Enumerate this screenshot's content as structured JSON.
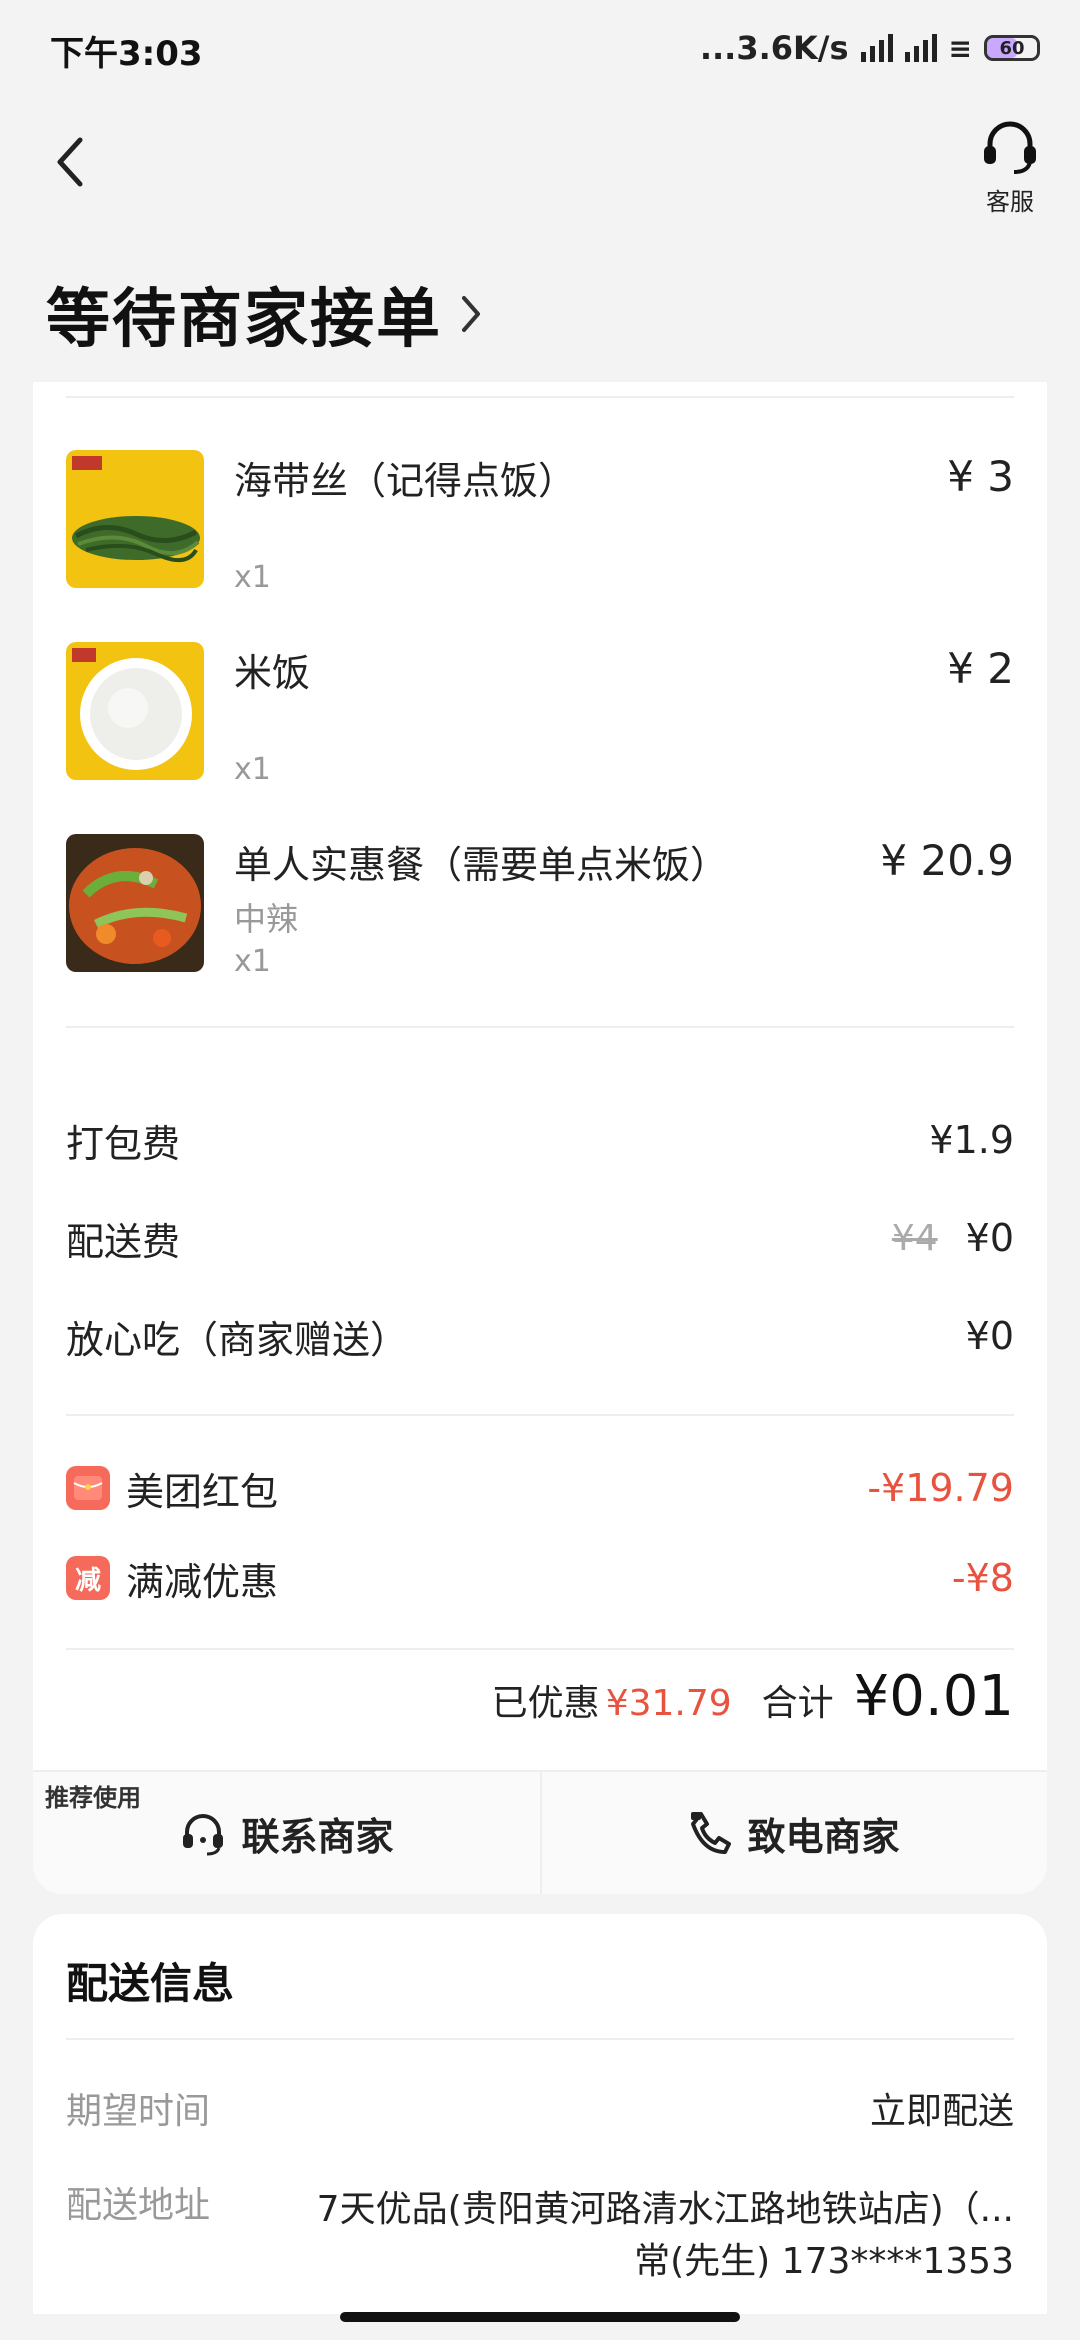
{
  "status_bar": {
    "time": "下午3:03",
    "net_speed": "...3.6K/s",
    "battery": "60"
  },
  "header": {
    "service_label": "客服",
    "title": "等待商家接单"
  },
  "items": [
    {
      "name": "海带丝（记得点饭）",
      "spec": "",
      "qty": "x1",
      "price": "¥ 3"
    },
    {
      "name": "米饭",
      "spec": "",
      "qty": "x1",
      "price": "¥ 2"
    },
    {
      "name": "单人实惠餐（需要单点米饭）",
      "spec": "中辣",
      "qty": "x1",
      "price": "¥ 20.9"
    }
  ],
  "fees": {
    "packing_label": "打包费",
    "packing_value": "¥1.9",
    "delivery_label": "配送费",
    "delivery_original": "¥4",
    "delivery_value": "¥0",
    "assurance_label": "放心吃（商家赠送）",
    "assurance_value": "¥0"
  },
  "discounts": {
    "redpacket_label": "美团红包",
    "redpacket_value": "-¥19.79",
    "reduction_icon": "减",
    "reduction_label": "满减优惠",
    "reduction_value": "-¥8"
  },
  "total": {
    "saved_label": "已优惠",
    "saved_value": "¥31.79",
    "sum_label": "合计",
    "sum_value": "¥0.01"
  },
  "contact": {
    "recommend_tag": "推荐使用",
    "chat_label": "联系商家",
    "call_label": "致电商家"
  },
  "delivery": {
    "title": "配送信息",
    "time_label": "期望时间",
    "time_value": "立即配送",
    "address_label": "配送地址",
    "address_value": "7天优品(贵阳黄河路清水江路地铁站店)（...",
    "contact_value": "常(先生) 173****1353"
  },
  "colors": {
    "accent_red": "#e8533f",
    "background": "#f3f3f3"
  }
}
